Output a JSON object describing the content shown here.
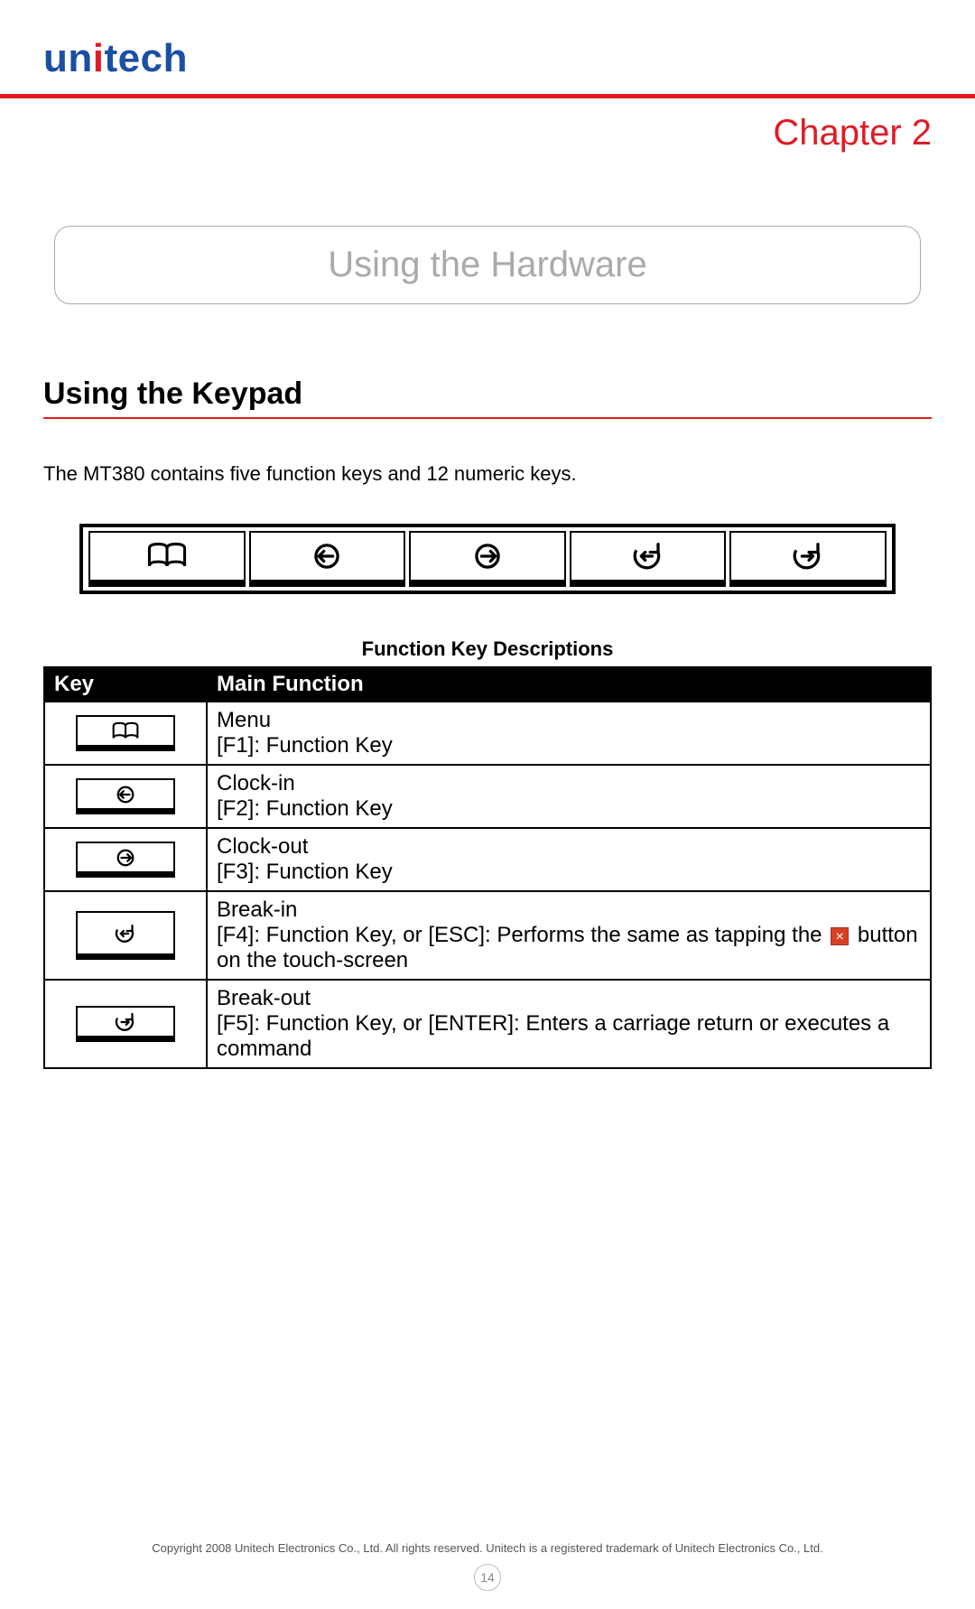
{
  "logo": {
    "part1": "un",
    "part2": "i",
    "part3": "tech"
  },
  "chapter": "Chapter 2",
  "title": "Using the Hardware",
  "section": "Using the Keypad",
  "intro": "The MT380 contains five function keys and 12 numeric keys.",
  "keypad_icons": [
    "book-icon",
    "clock-in-icon",
    "clock-out-icon",
    "break-in-icon",
    "break-out-icon"
  ],
  "table": {
    "caption": "Function Key Descriptions",
    "headers": {
      "key": "Key",
      "func": "Main Function"
    },
    "rows": [
      {
        "icon": "book-icon",
        "label": "Menu",
        "desc": "[F1]: Function Key"
      },
      {
        "icon": "clock-in-icon",
        "label": "Clock-in",
        "desc": "[F2]: Function Key"
      },
      {
        "icon": "clock-out-icon",
        "label": "Clock-out",
        "desc": "[F3]: Function Key"
      },
      {
        "icon": "break-in-icon",
        "label": "Break-in",
        "desc_pre": "[F4]: Function Key, or [ESC]: Performs the same as tapping the ",
        "desc_post": " button on the touch-screen",
        "has_x_badge": true,
        "x_badge": "×"
      },
      {
        "icon": "break-out-icon",
        "label": "Break-out",
        "desc": "[F5]: Function Key, or [ENTER]: Enters a carriage return or executes a command"
      }
    ]
  },
  "footer": "Copyright 2008 Unitech Electronics Co., Ltd. All rights reserved. Unitech is a registered trademark of Unitech Electronics Co., Ltd.",
  "page_number": "14"
}
